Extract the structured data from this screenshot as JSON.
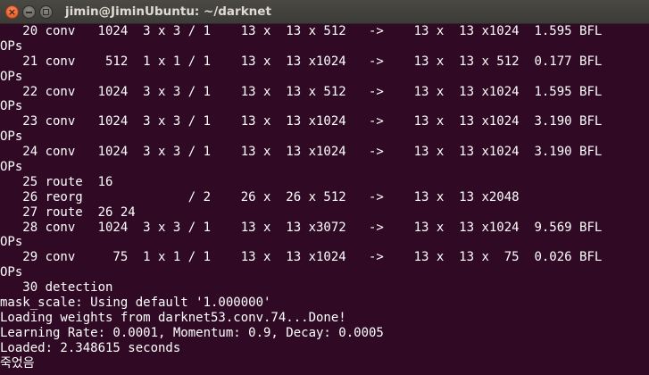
{
  "window": {
    "title": "jimin@JiminUbuntu: ~/darknet",
    "close_glyph": "×",
    "background_color": "#300a24",
    "text_color": "#ffffff"
  },
  "terminal": {
    "lines": [
      "   20 conv   1024  3 x 3 / 1    13 x  13 x 512   ->    13 x  13 x1024  1.595 BFL",
      "OPs",
      "   21 conv    512  1 x 1 / 1    13 x  13 x1024   ->    13 x  13 x 512  0.177 BFL",
      "OPs",
      "   22 conv   1024  3 x 3 / 1    13 x  13 x 512   ->    13 x  13 x1024  1.595 BFL",
      "OPs",
      "   23 conv   1024  3 x 3 / 1    13 x  13 x1024   ->    13 x  13 x1024  3.190 BFL",
      "OPs",
      "   24 conv   1024  3 x 3 / 1    13 x  13 x1024   ->    13 x  13 x1024  3.190 BFL",
      "OPs",
      "   25 route  16",
      "   26 reorg              / 2    26 x  26 x 512   ->    13 x  13 x2048",
      "   27 route  26 24",
      "   28 conv   1024  3 x 3 / 1    13 x  13 x3072   ->    13 x  13 x1024  9.569 BFL",
      "OPs",
      "   29 conv     75  1 x 1 / 1    13 x  13 x1024   ->    13 x  13 x  75  0.026 BFL",
      "OPs",
      "   30 detection",
      "mask_scale: Using default '1.000000'",
      "Loading weights from darknet53.conv.74...Done!",
      "Learning Rate: 0.0001, Momentum: 0.9, Decay: 0.0005",
      "Loaded: 2.348615 seconds",
      "죽었음"
    ]
  }
}
